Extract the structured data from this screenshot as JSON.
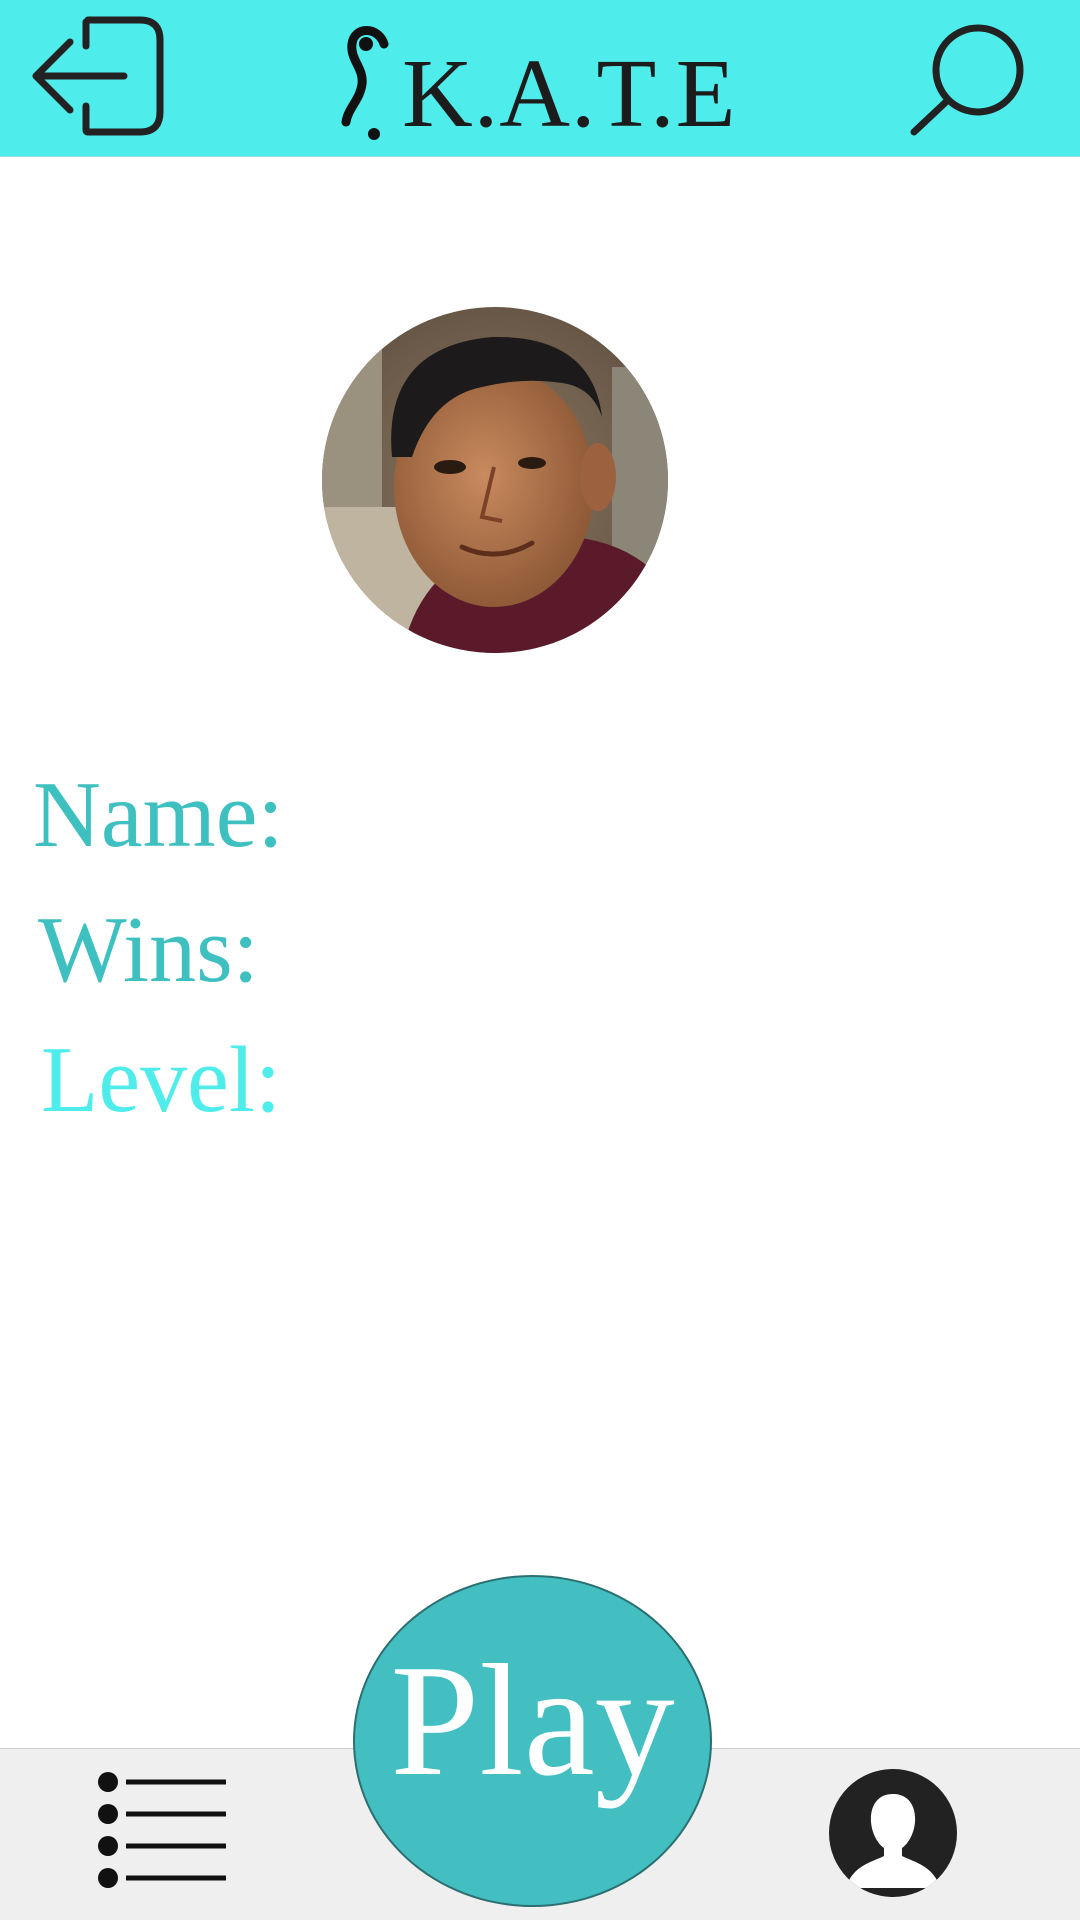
{
  "theme": {
    "header_bg": "#4fecec",
    "accent": "#3ebfc0",
    "accent_light": "#4fecec",
    "play_bg": "#43bfc2",
    "bottom_bar_bg": "#efefef",
    "icon_color": "#222222"
  },
  "header": {
    "left_icon": "logout-icon",
    "logo_text": "K.A.T.E",
    "right_icon": "search-icon"
  },
  "profile": {
    "avatar_icon": "profile-photo",
    "name_label": "Name:",
    "wins_label": "Wins:",
    "level_label": "Level:"
  },
  "bottom_bar": {
    "left_icon": "list-menu-icon",
    "play_label": "Play",
    "right_icon": "user-profile-icon"
  }
}
